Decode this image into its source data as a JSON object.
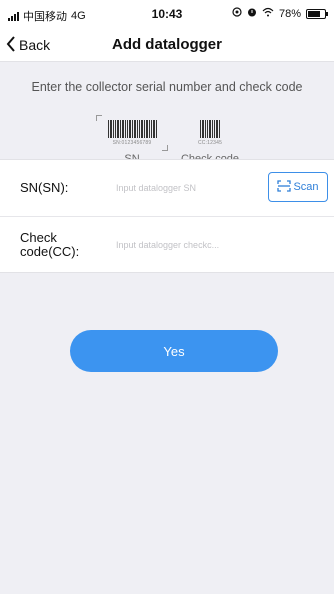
{
  "status_bar": {
    "carrier": "中国移动",
    "network": "4G",
    "time": "10:43",
    "battery": "78%",
    "battery_level": 0.78,
    "icons": [
      "signal-icon",
      "location-icon",
      "alarm-icon",
      "wifi-icon",
      "battery-icon"
    ]
  },
  "nav": {
    "back_label": "Back",
    "back_icon": "chevron-left-icon",
    "title": "Add datalogger"
  },
  "instruction": "Enter the collector serial number and check code",
  "barcodes": {
    "sn_code": "SN:0123456789",
    "sn_label": "SN",
    "cc_code": "CC:12345",
    "cc_label": "Check code"
  },
  "form": {
    "sn_label": "SN(SN):",
    "sn_placeholder": "Input datalogger SN",
    "scan_label": "Scan",
    "scan_icon": "scan-icon",
    "cc_label_line1": "Check",
    "cc_label_line2": "code(CC):",
    "cc_placeholder": "Input datalogger checkc..."
  },
  "actions": {
    "yes_label": "Yes"
  },
  "colors": {
    "accent": "#3c94f0",
    "background": "#efeff4",
    "surface": "#ffffff"
  }
}
